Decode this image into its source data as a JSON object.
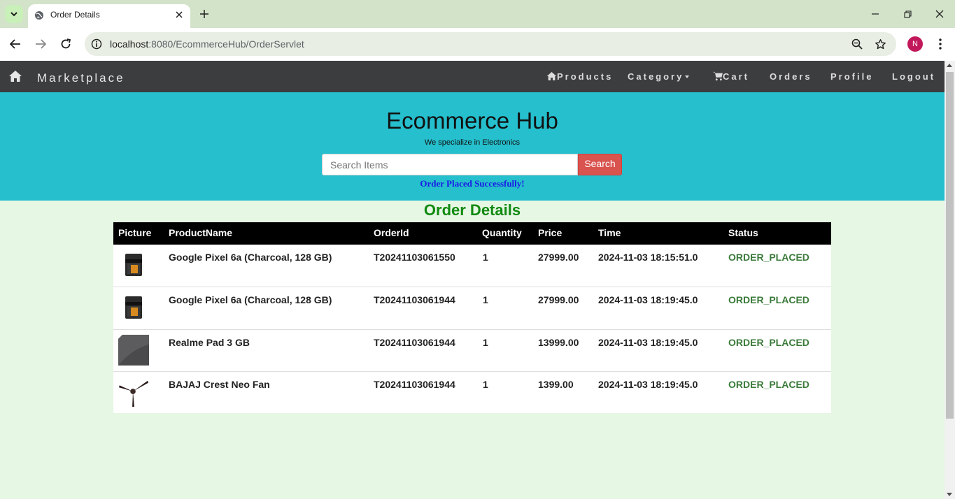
{
  "browser": {
    "tab_title": "Order Details",
    "url_host": "localhost",
    "url_rest": ":8080/EcommerceHub/OrderServlet",
    "profile_initial": "N"
  },
  "navbar": {
    "brand": "Marketplace",
    "links": {
      "products": "Products",
      "category": "Category",
      "cart": "Cart",
      "orders": "Orders",
      "profile": "Profile",
      "logout": "Logout"
    }
  },
  "banner": {
    "title": "Ecommerce Hub",
    "tagline": "We specialize in Electronics",
    "search_placeholder": "Search Items",
    "search_button": "Search",
    "message": "Order Placed Successfully!"
  },
  "orders": {
    "title": "Order Details",
    "columns": {
      "picture": "Picture",
      "product": "ProductName",
      "order_id": "OrderId",
      "quantity": "Quantity",
      "price": "Price",
      "time": "Time",
      "status": "Status"
    },
    "rows": [
      {
        "product": "Google Pixel 6a (Charcoal, 128 GB)",
        "order_id": "T20241103061550",
        "quantity": "1",
        "price": "27999.00",
        "time": "2024-11-03 18:15:51.0",
        "status": "ORDER_PLACED",
        "image": "phone-icon"
      },
      {
        "product": "Google Pixel 6a (Charcoal, 128 GB)",
        "order_id": "T20241103061944",
        "quantity": "1",
        "price": "27999.00",
        "time": "2024-11-03 18:19:45.0",
        "status": "ORDER_PLACED",
        "image": "phone-icon"
      },
      {
        "product": "Realme Pad 3 GB",
        "order_id": "T20241103061944",
        "quantity": "1",
        "price": "13999.00",
        "time": "2024-11-03 18:19:45.0",
        "status": "ORDER_PLACED",
        "image": "tablet-icon"
      },
      {
        "product": "BAJAJ Crest Neo Fan",
        "order_id": "T20241103061944",
        "quantity": "1",
        "price": "1399.00",
        "time": "2024-11-03 18:19:45.0",
        "status": "ORDER_PLACED",
        "image": "fan-icon"
      }
    ]
  },
  "colors": {
    "navbar": "#3c3d3f",
    "banner": "#25bfcd",
    "page_bg": "#e6f7e4",
    "title_green": "#118a11",
    "status_green": "#3a7a3a",
    "search_button": "#d9534f",
    "message_blue": "#1a1ae6"
  }
}
